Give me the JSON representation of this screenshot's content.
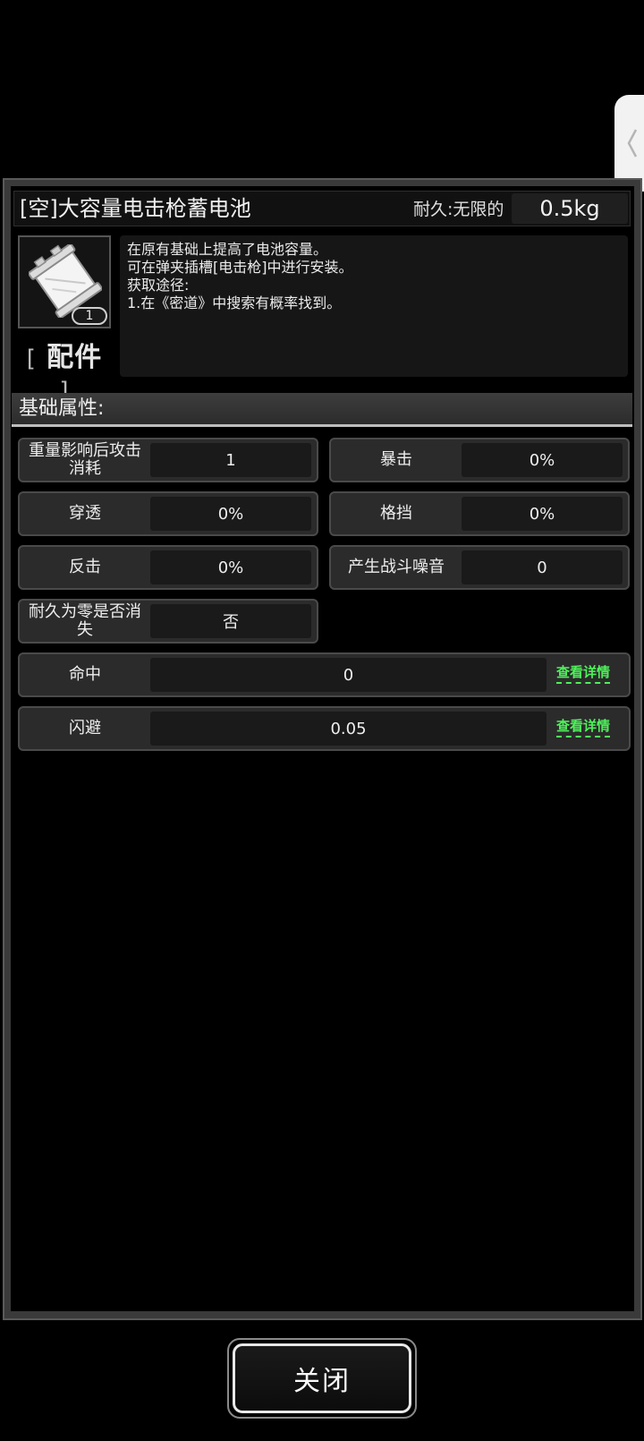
{
  "item": {
    "title": "[空]大容量电击枪蓄电池",
    "durability_label": "耐久:无限的",
    "weight": "0.5kg",
    "count": "1",
    "type_open": "[",
    "type": "配件",
    "type_close": "]",
    "description": [
      "在原有基础上提高了电池容量。",
      "可在弹夹插槽[电击枪]中进行安装。",
      "获取途径:",
      "1.在《密道》中搜索有概率找到。"
    ]
  },
  "section": {
    "title": "基础属性:"
  },
  "attributes": [
    {
      "label": "重量影响后攻击消耗",
      "value": "1"
    },
    {
      "label": "暴击",
      "value": "0%"
    },
    {
      "label": "穿透",
      "value": "0%"
    },
    {
      "label": "格挡",
      "value": "0%"
    },
    {
      "label": "反击",
      "value": "0%"
    },
    {
      "label": "产生战斗噪音",
      "value": "0"
    },
    {
      "label": "耐久为零是否消失",
      "value": "否"
    }
  ],
  "wide_attributes": [
    {
      "label": "命中",
      "value": "0",
      "link": "查看详情"
    },
    {
      "label": "闪避",
      "value": "0.05",
      "link": "查看详情"
    }
  ],
  "footer": {
    "close_label": "关闭"
  },
  "icons": {
    "item": "battery-pack-icon",
    "side_tab": "chevron-left-icon"
  },
  "colors": {
    "link": "#4ef05a",
    "panel": "#3a3a3a",
    "background": "#000000"
  }
}
